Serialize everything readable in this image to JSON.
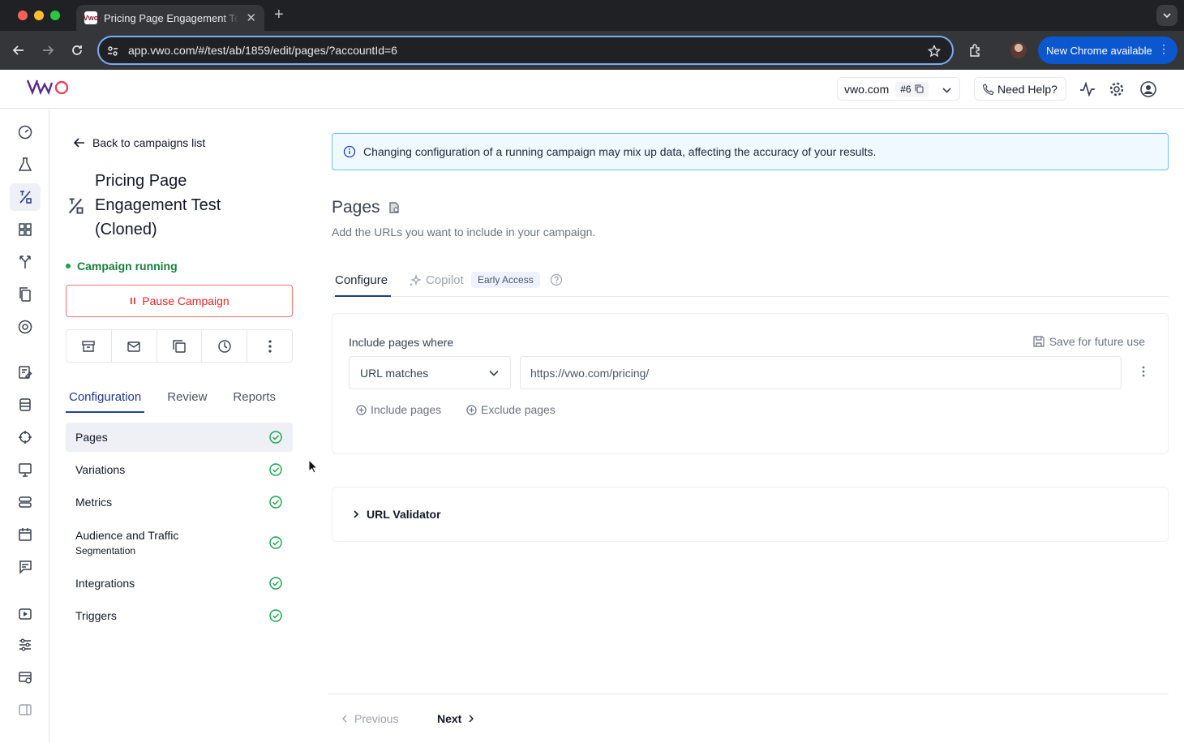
{
  "browser": {
    "tab_title": "Pricing Page Engagement Test",
    "favicon_text": "Vwo",
    "url": "app.vwo.com/#/test/ab/1859/edit/pages/?accountId=6",
    "new_chrome_label": "New Chrome available"
  },
  "header": {
    "logo": "VWO",
    "account_name": "vwo.com",
    "account_id": "#6",
    "help_label": "Need Help?"
  },
  "left_panel": {
    "back_label": "Back to campaigns list",
    "campaign_title": "Pricing Page Engagement Test (Cloned)",
    "status": "Campaign running",
    "pause_label": "Pause Campaign",
    "tabs": [
      "Configuration",
      "Review",
      "Reports"
    ],
    "menu": [
      {
        "label": "Pages",
        "sub": ""
      },
      {
        "label": "Variations",
        "sub": ""
      },
      {
        "label": "Metrics",
        "sub": ""
      },
      {
        "label": "Audience and Traffic",
        "sub": "Segmentation"
      },
      {
        "label": "Integrations",
        "sub": ""
      },
      {
        "label": "Triggers",
        "sub": ""
      }
    ]
  },
  "main": {
    "notice": "Changing configuration of a running campaign may mix up data, affecting the accuracy of your results.",
    "title": "Pages",
    "description": "Add the URLs you want to include in your campaign.",
    "tabs": {
      "configure": "Configure",
      "copilot": "Copilot",
      "early_access": "Early Access"
    },
    "include_label": "Include pages where",
    "save_future": "Save for future use",
    "match_type": "URL matches",
    "url_value": "https://vwo.com/pricing/",
    "include_pages": "Include pages",
    "exclude_pages": "Exclude pages",
    "validator": "URL Validator",
    "previous": "Previous",
    "next": "Next"
  },
  "colors": {
    "accent": "#1e3a8a",
    "success": "#16a34a",
    "danger": "#dc2626",
    "notice_border": "#67c6e4"
  }
}
